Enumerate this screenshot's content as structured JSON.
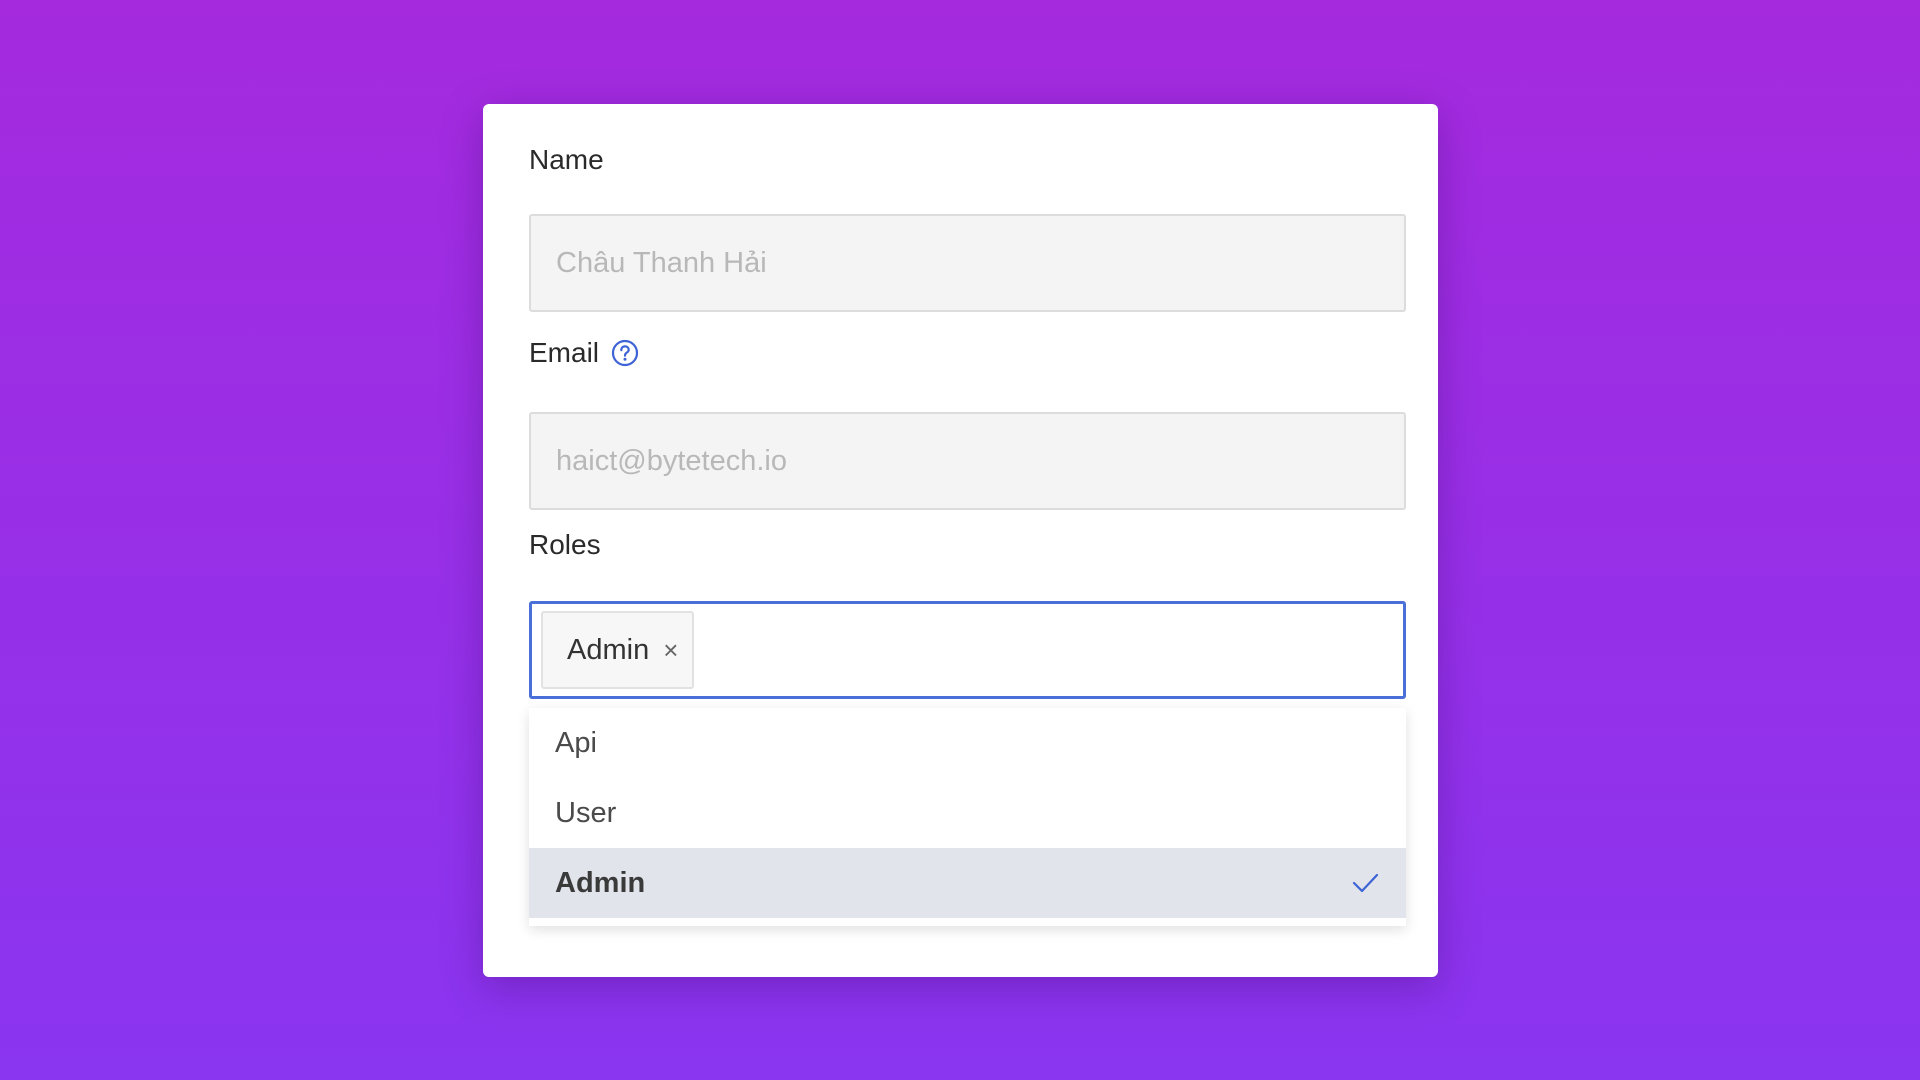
{
  "form": {
    "name": {
      "label": "Name",
      "placeholder": "Châu Thanh Hải",
      "value": ""
    },
    "email": {
      "label": "Email",
      "help_icon": "question-circle-icon",
      "placeholder": "haict@bytetech.io",
      "value": ""
    },
    "roles": {
      "label": "Roles",
      "selected_tags": [
        {
          "label": "Admin",
          "remove_icon": "close-icon"
        }
      ],
      "options": [
        {
          "label": "Api",
          "selected": false
        },
        {
          "label": "User",
          "selected": false
        },
        {
          "label": "Admin",
          "selected": true,
          "icon": "check-icon"
        }
      ]
    }
  },
  "colors": {
    "background_top": "#a52ade",
    "background_bottom": "#8a35f0",
    "accent": "#4a6fd8",
    "selected_option_bg": "#e1e4ea"
  }
}
